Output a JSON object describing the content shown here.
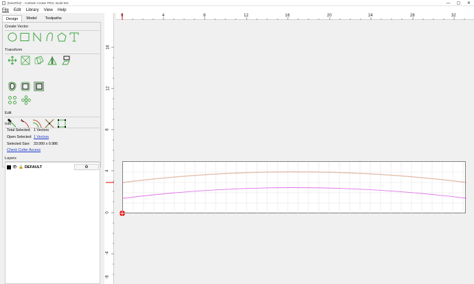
{
  "window": {
    "title": "[NewFile]* - Carbide Create PRO, Build 841",
    "minimize_glyph": "—",
    "maximize_glyph": "▢",
    "close_glyph": "✕"
  },
  "menu": [
    "File",
    "Edit",
    "Library",
    "View",
    "Help"
  ],
  "tabs": [
    "Design",
    "Model",
    "Toolpaths"
  ],
  "sections": {
    "create_vector": "Create Vector",
    "transform": "Transform",
    "edit": "Edit",
    "info": "Info",
    "layers": "Layers"
  },
  "create_vector_tools": [
    "circle-icon",
    "rectangle-icon",
    "polyline-icon",
    "curve-icon",
    "polygon-icon",
    "text-icon"
  ],
  "transform_tools": [
    "move-icon",
    "scale-icon",
    "rotate-icon",
    "mirror-icon",
    "skew-icon",
    "offset-icon",
    "rounded-rect-icon",
    "boolean-icon",
    "array-icon",
    "circular-array-icon"
  ],
  "edit_tools": [
    "edit-nodes-icon",
    "trim-icon",
    "join-icon",
    "cut-icon",
    "fit-curve-icon"
  ],
  "info": {
    "total_selected_label": "Total Selected:",
    "total_selected_value": "1 Vectors",
    "open_selected_label": "Open Selected:",
    "open_selected_value": "1 Vectors",
    "selected_size_label": "Selected Size:",
    "selected_size_value": "33.000 x 0.986",
    "check_cutter": "Check Cutter Access"
  },
  "layers": [
    {
      "name": "DEFAULT",
      "eye": "👁",
      "lock": "🔓",
      "settings": "⚙"
    }
  ],
  "rulers": {
    "horizontal": [
      "0",
      "4",
      "8",
      "12",
      "16",
      "20",
      "24",
      "28",
      "32"
    ],
    "vertical": [
      "16",
      "12",
      "8",
      "4",
      "0",
      "-4",
      "-8"
    ]
  },
  "colors": {
    "accent": "#1a37c8",
    "tool_green": "#3da33d",
    "vector_orange": "#d4a083",
    "vector_magenta": "#e070e8",
    "origin_red": "#e00000"
  }
}
